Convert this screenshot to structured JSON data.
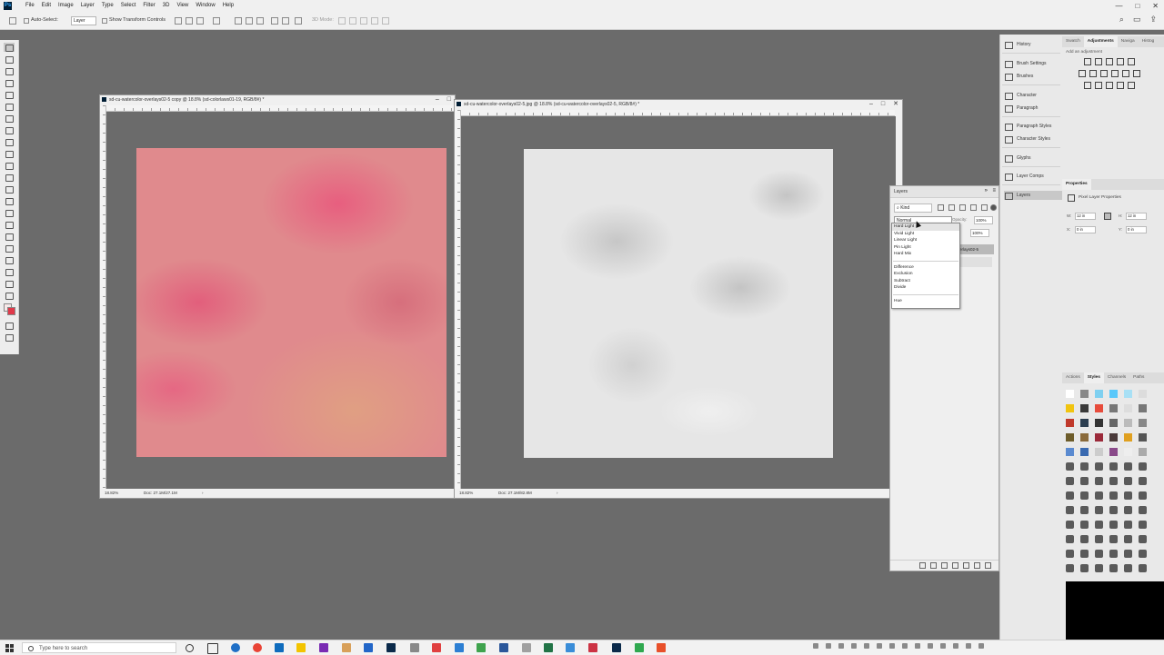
{
  "app": {
    "menu": [
      "File",
      "Edit",
      "Image",
      "Layer",
      "Type",
      "Select",
      "Filter",
      "3D",
      "View",
      "Window",
      "Help"
    ],
    "window_controls": [
      "—",
      "□",
      "✕"
    ]
  },
  "options_bar": {
    "auto_select_label": "Auto-Select:",
    "auto_select_value": "Layer",
    "transform_label": "Show Transform Controls",
    "mode_3d_label": "3D Mode:"
  },
  "doc_left": {
    "title": "sd-cu-watercolor-overlays02-5 copy @ 18.8% (sd-colorlaws01-19, RGB/8#) *",
    "zoom": "18.82%",
    "doc_size": "Doc: 27.1M/27.1M"
  },
  "doc_right": {
    "title": "sd-cu-watercolor-overlays02-5.jpg @ 18.8% (sd-cu-watercolor-overlays02-5, RGB/8#) *",
    "zoom": "18.82%",
    "doc_size": "Doc: 27.1M/82.8M"
  },
  "layers_panel": {
    "title": "Layers",
    "kind_label": "Kind",
    "blend_mode": "Normal",
    "opacity_label": "Opacity:",
    "opacity_value": "100%",
    "fill_label": "Fill:",
    "fill_value": "100%",
    "layer_name": "erlays02-5"
  },
  "blend_dropdown": {
    "group1": [
      "Hard Light",
      "Vivid Light",
      "Linear Light",
      "Pin Light",
      "Hard Mix"
    ],
    "group2": [
      "Difference",
      "Exclusion",
      "Subtract",
      "Divide"
    ],
    "group3": [
      "Hue"
    ]
  },
  "panel_strip": {
    "items": [
      "History",
      "Brush Settings",
      "Brushes",
      "Character",
      "Paragraph",
      "Paragraph Styles",
      "Character Styles",
      "Glyphs",
      "Layer Comps",
      "Layers"
    ]
  },
  "right_panels": {
    "top_tabs": [
      "Swatch",
      "Adjustments",
      "Naviga",
      "Histog"
    ],
    "add_adjustment": "Add an adjustment",
    "properties_title": "Properties",
    "pixel_layer_props": "Pixel Layer Properties",
    "w_label": "W:",
    "w_value": "12 in",
    "h_label": "H:",
    "h_value": "12 in",
    "x_label": "X:",
    "x_value": "0 in",
    "y_label": "Y:",
    "y_value": "0 in",
    "bottom_tabs": [
      "Actions",
      "Styles",
      "Channels",
      "Paths"
    ]
  },
  "taskbar": {
    "search_placeholder": "Type here to search"
  },
  "colors": {
    "fg_color": "#f7e8e8",
    "bg_color": "#e0394a",
    "pink_canvas": "#e08a8d",
    "gray_canvas": "#e6e6e6"
  }
}
